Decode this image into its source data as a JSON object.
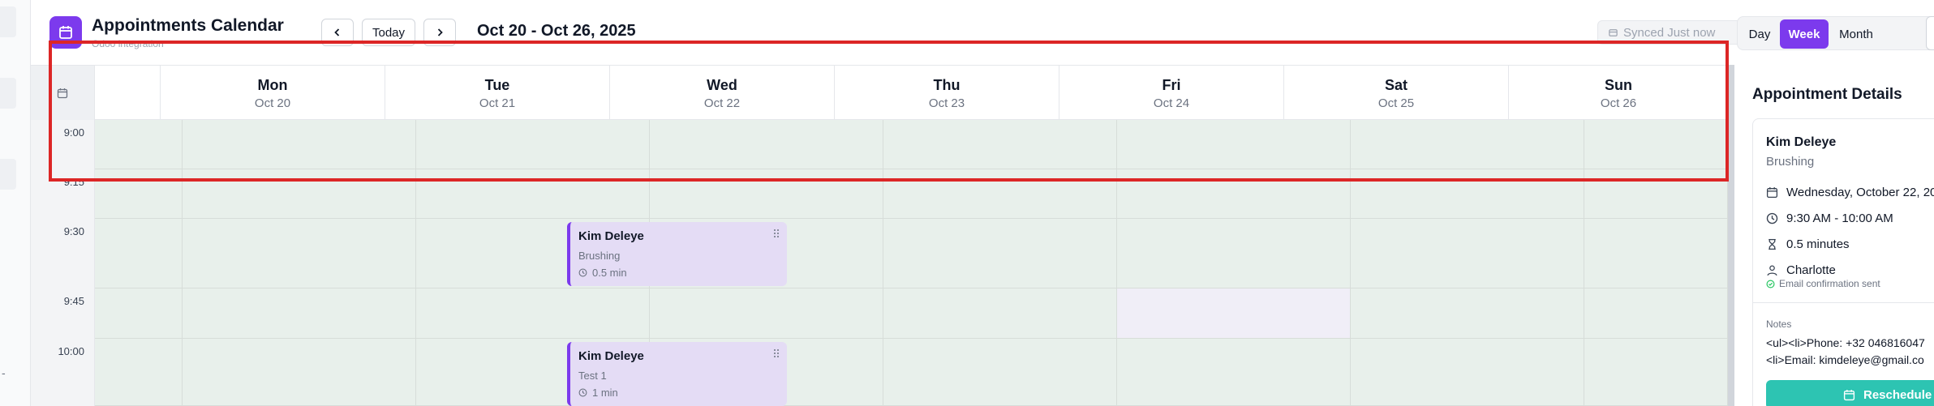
{
  "header": {
    "title": "Appointments Calendar",
    "subtitle": "Odoo integration",
    "prev_icon": "chevron-left-icon",
    "today_label": "Today",
    "next_icon": "chevron-right-icon",
    "date_range": "Oct 20 - Oct 26, 2025",
    "sync_status": "Synced Just now",
    "views": [
      "Day",
      "Week",
      "Month"
    ],
    "active_view": "Week",
    "accent_color": "#7c3aed"
  },
  "calendar": {
    "days": [
      {
        "name": "Mon",
        "date": "Oct 20"
      },
      {
        "name": "Tue",
        "date": "Oct 21"
      },
      {
        "name": "Wed",
        "date": "Oct 22"
      },
      {
        "name": "Thu",
        "date": "Oct 23"
      },
      {
        "name": "Fri",
        "date": "Oct 24"
      },
      {
        "name": "Sat",
        "date": "Oct 25"
      },
      {
        "name": "Sun",
        "date": "Oct 26"
      }
    ],
    "times": [
      "9:00",
      "9:15",
      "9:30",
      "9:45",
      "10:00"
    ],
    "available_color": "#e8f0eb",
    "blocked_color": "#f0eef7",
    "events": [
      {
        "name": "Kim Deleye",
        "service": "Brushing",
        "duration": "0.5 min",
        "day": "Wed",
        "start": "9:30"
      },
      {
        "name": "Kim Deleye",
        "service": "Test 1",
        "duration": "1 min",
        "day": "Wed",
        "start": "10:00"
      }
    ]
  },
  "details": {
    "title": "Appointment Details",
    "client_name": "Kim Deleye",
    "service": "Brushing",
    "date": "Wednesday, October 22, 20",
    "time": "9:30 AM - 10:00 AM",
    "duration": "0.5 minutes",
    "staff": "Charlotte",
    "confirmation": "Email confirmation sent",
    "notes_label": "Notes",
    "notes_line1": "<ul><li>Phone: +32 046816047",
    "notes_line2": "<li>Email: kimdeleye@gmail.co",
    "reschedule_label": "Reschedule",
    "reschedule_color": "#2dc4b2"
  }
}
